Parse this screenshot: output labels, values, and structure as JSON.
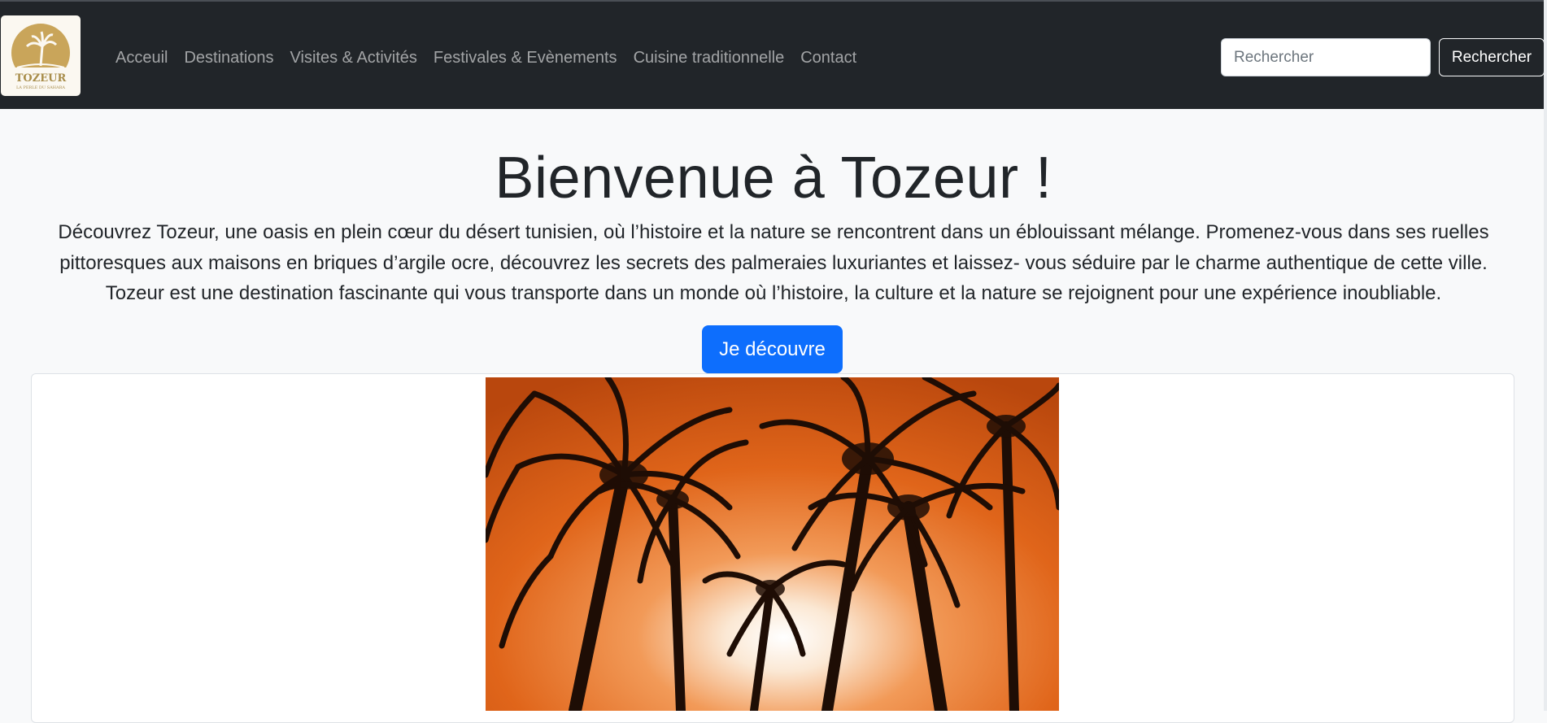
{
  "navbar": {
    "logo": {
      "title": "TOZEUR",
      "tagline": "LA PERLE DU SAHARA"
    },
    "links": [
      {
        "label": "Acceuil"
      },
      {
        "label": "Destinations"
      },
      {
        "label": "Visites & Activités"
      },
      {
        "label": "Festivales & Evènements"
      },
      {
        "label": "Cuisine traditionnelle"
      },
      {
        "label": "Contact"
      }
    ],
    "search": {
      "placeholder": "Rechercher",
      "value": "",
      "button_label": "Rechercher"
    }
  },
  "hero": {
    "title": "Bienvenue à Tozeur !",
    "lead": "Découvrez Tozeur, une oasis en plein cœur du désert tunisien, où l’histoire et la nature se rencontrent dans un éblouissant mélange. Promenez-vous dans ses ruelles pittoresques aux maisons en briques d’argile ocre, découvrez les secrets des palmeraies luxuriantes et laissez- vous séduire par le charme authentique de cette ville. Tozeur est une destination fascinante qui vous transporte dans un monde où l’histoire, la culture et la nature se rejoignent pour une expérience inoubliable.",
    "cta_label": "Je découvre"
  },
  "colors": {
    "navbar_bg": "#212529",
    "primary": "#0d6efd",
    "page_bg": "#f8f9fa",
    "logo_gold": "#c9a55a",
    "sky_orange": "#e0651a"
  },
  "icons": {
    "logo": "palm-tree-sun-logo"
  }
}
